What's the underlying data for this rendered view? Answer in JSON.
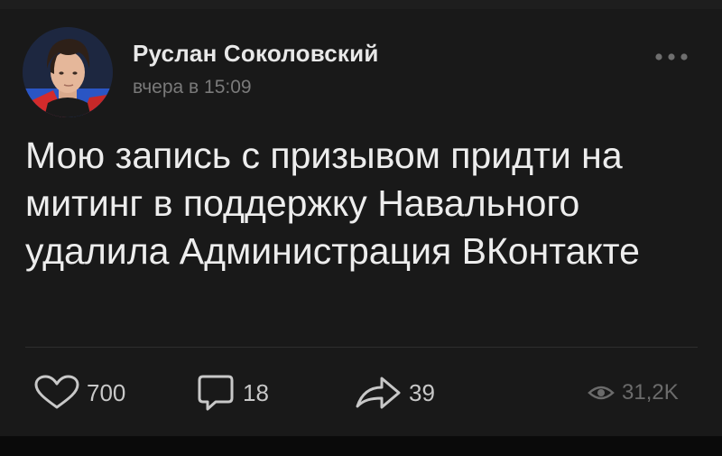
{
  "colors": {
    "background": "#191919",
    "text_primary": "#ededed",
    "text_secondary": "#7a7a7a",
    "icon": "#c8c8c8"
  },
  "post": {
    "author": {
      "name": "Руслан Соколовский",
      "avatar": "user-portrait-avatar"
    },
    "time": "вчера в 15:09",
    "text": "Мою запись с призывом придти на митинг в поддержку Навального удалила Администрация ВКонтакте",
    "actions": {
      "likes": {
        "icon": "heart-icon",
        "count": "700"
      },
      "comments": {
        "icon": "comment-icon",
        "count": "18"
      },
      "shares": {
        "icon": "share-arrow-icon",
        "count": "39"
      },
      "views": {
        "icon": "eye-icon",
        "count": "31,2K"
      }
    },
    "menu_icon": "more-dots-icon"
  }
}
